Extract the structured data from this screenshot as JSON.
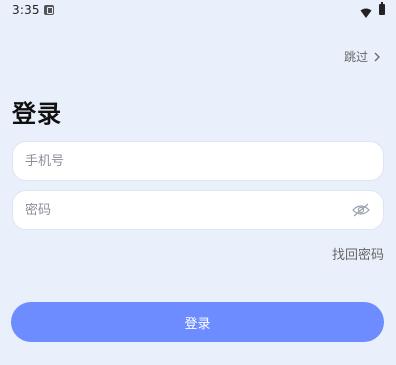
{
  "status_bar": {
    "time": "3:35",
    "icons": [
      "notification-icon",
      "wifi-icon",
      "battery-icon"
    ]
  },
  "header": {
    "skip_label": "跳过",
    "skip_icon": "chevron-right-icon"
  },
  "login": {
    "title": "登录",
    "phone_placeholder": "手机号",
    "password_placeholder": "密码",
    "password_toggle_icon": "eye-off-icon",
    "forgot_label": "找回密码",
    "submit_label": "登录"
  },
  "colors": {
    "background": "#eaf0fb",
    "primary": "#6c8cff",
    "field_background": "#ffffff"
  }
}
